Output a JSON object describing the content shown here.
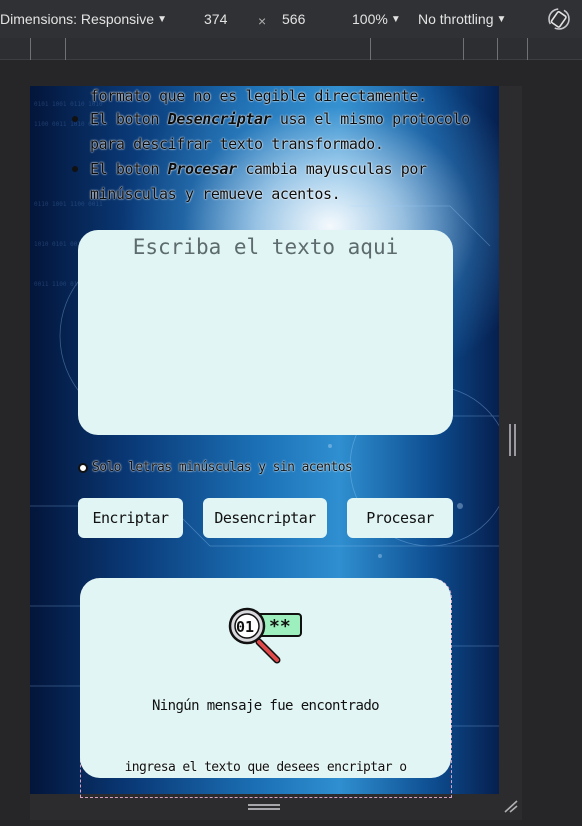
{
  "devtools": {
    "dimensions_label": "Dimensions: Responsive",
    "width_value": "374",
    "times_symbol": "×",
    "height_value": "566",
    "zoom_label": "100%",
    "throttling_label": "No throttling",
    "rotate_icon": "rotate-icon",
    "caret_icon": "▼"
  },
  "page": {
    "info_lines": {
      "line0": "formato que no es legible directamente.",
      "line1_pre": "El boton ",
      "line1_bold": "Desencriptar",
      "line1_post": " usa el mismo protocolo",
      "line2": "para descifrar texto transformado.",
      "line3_pre": "El boton ",
      "line3_bold": "Procesar",
      "line3_post": " cambia mayusculas por",
      "line4": "minúsculas y remueve acentos."
    },
    "input": {
      "placeholder": "Escriba el texto aqui"
    },
    "notice": "Solo letras minúsculas y sin acentos",
    "buttons": {
      "encrypt": "Encriptar",
      "decrypt": "Desencriptar",
      "process": "Procesar"
    },
    "output": {
      "icon": "magnifier-binary-icon",
      "icon_text": "01",
      "icon_password": "**",
      "title": "Ningún mensaje fue encontrado",
      "subtitle": "ingresa el texto que desees encriptar o"
    }
  },
  "colors": {
    "card_bg": "#e1f6f4",
    "devtools_bg": "#303134",
    "text_dark": "#111111",
    "output_border": "#d9a2c3"
  }
}
